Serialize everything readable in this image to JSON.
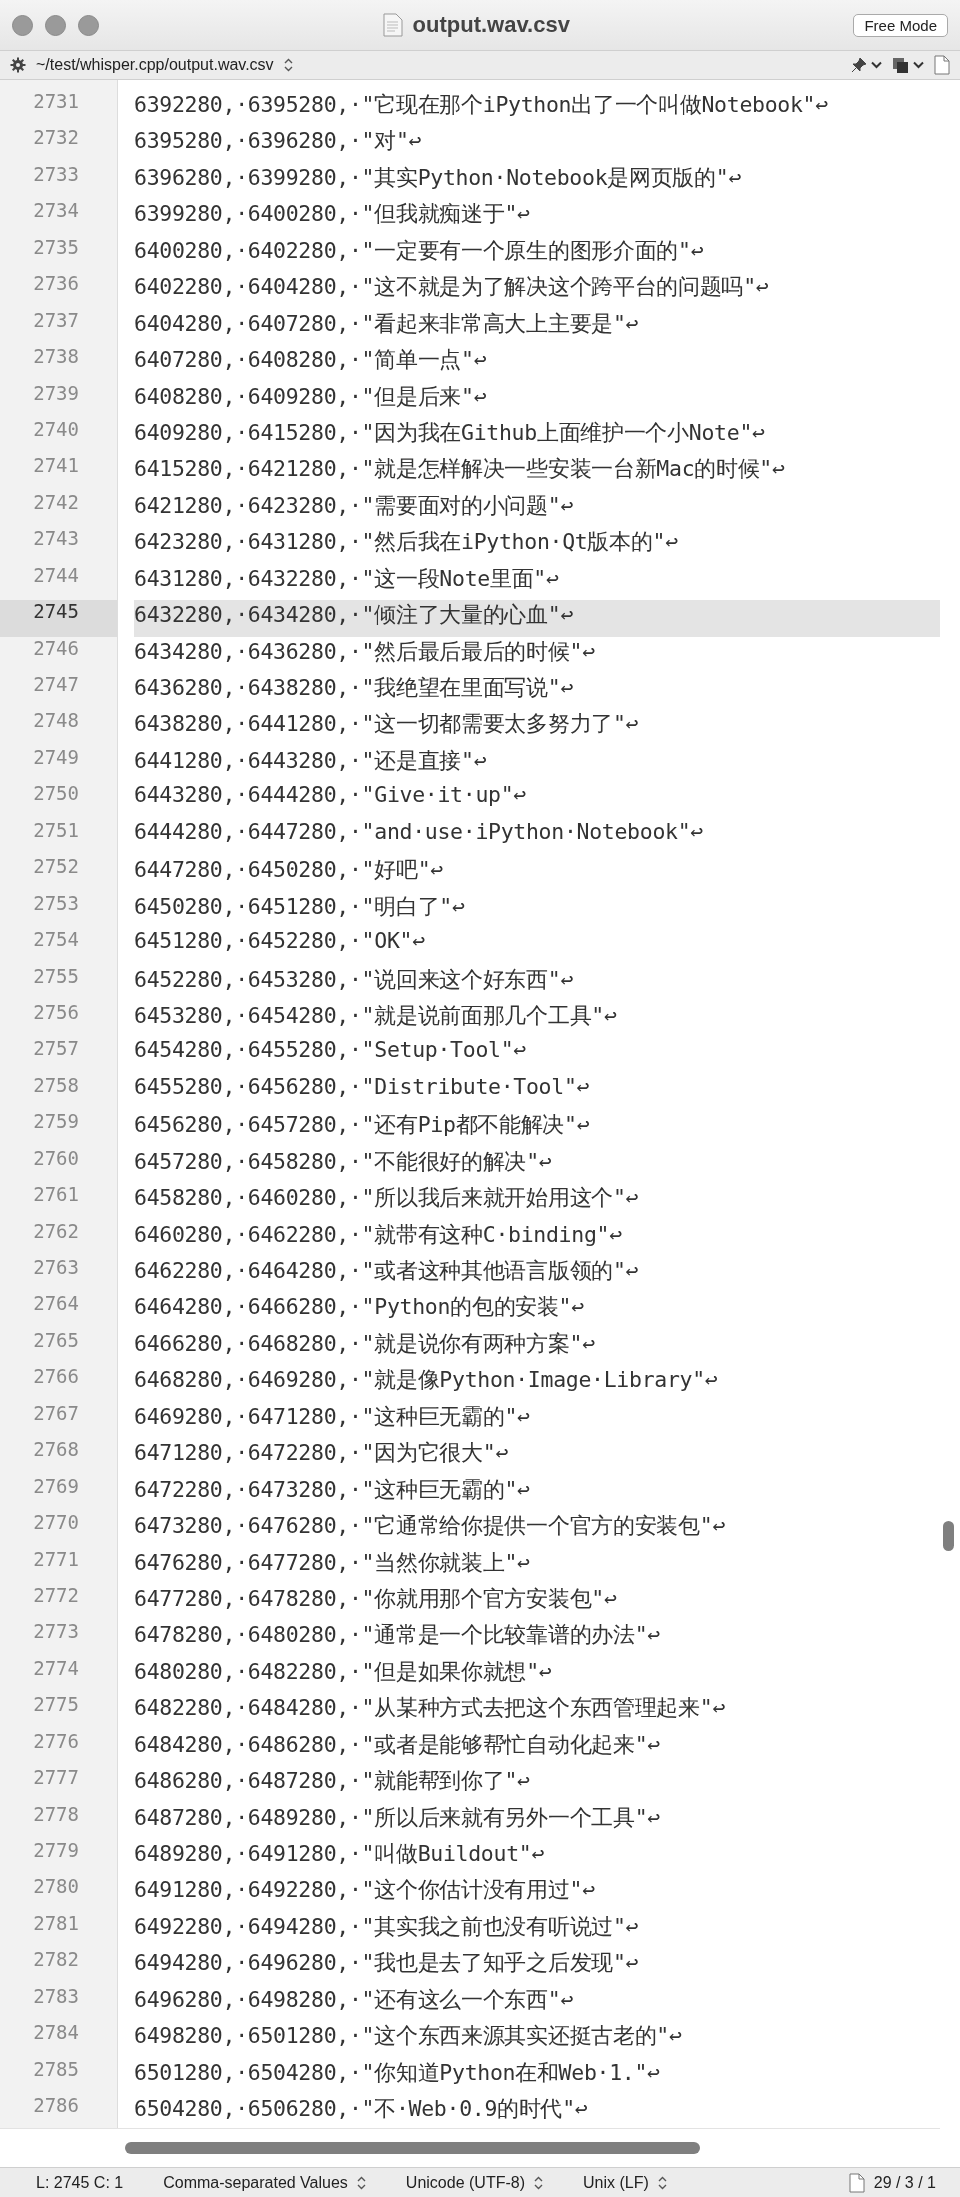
{
  "window": {
    "title": "output.wav.csv",
    "mode_button": "Free Mode"
  },
  "path_bar": {
    "path": "~/test/whisper.cpp/output.wav.csv"
  },
  "editor": {
    "lines": [
      {
        "number": "2731",
        "text": "6392280,·6395280,·\"它现在那个iPython出了一个叫做Notebook\"↩",
        "selected": false
      },
      {
        "number": "2732",
        "text": "6395280,·6396280,·\"对\"↩",
        "selected": false
      },
      {
        "number": "2733",
        "text": "6396280,·6399280,·\"其实Python·Notebook是网页版的\"↩",
        "selected": false
      },
      {
        "number": "2734",
        "text": "6399280,·6400280,·\"但我就痴迷于\"↩",
        "selected": false
      },
      {
        "number": "2735",
        "text": "6400280,·6402280,·\"一定要有一个原生的图形介面的\"↩",
        "selected": false
      },
      {
        "number": "2736",
        "text": "6402280,·6404280,·\"这不就是为了解决这个跨平台的问题吗\"↩",
        "selected": false
      },
      {
        "number": "2737",
        "text": "6404280,·6407280,·\"看起来非常高大上主要是\"↩",
        "selected": false
      },
      {
        "number": "2738",
        "text": "6407280,·6408280,·\"简单一点\"↩",
        "selected": false
      },
      {
        "number": "2739",
        "text": "6408280,·6409280,·\"但是后来\"↩",
        "selected": false
      },
      {
        "number": "2740",
        "text": "6409280,·6415280,·\"因为我在Github上面维护一个小Note\"↩",
        "selected": false
      },
      {
        "number": "2741",
        "text": "6415280,·6421280,·\"就是怎样解决一些安装一台新Mac的时候\"↩",
        "selected": false
      },
      {
        "number": "2742",
        "text": "6421280,·6423280,·\"需要面对的小问题\"↩",
        "selected": false
      },
      {
        "number": "2743",
        "text": "6423280,·6431280,·\"然后我在iPython·Qt版本的\"↩",
        "selected": false
      },
      {
        "number": "2744",
        "text": "6431280,·6432280,·\"这一段Note里面\"↩",
        "selected": false
      },
      {
        "number": "2745",
        "text": "6432280,·6434280,·\"倾注了大量的心血\"↩",
        "selected": true
      },
      {
        "number": "2746",
        "text": "6434280,·6436280,·\"然后最后最后的时候\"↩",
        "selected": false
      },
      {
        "number": "2747",
        "text": "6436280,·6438280,·\"我绝望在里面写说\"↩",
        "selected": false
      },
      {
        "number": "2748",
        "text": "6438280,·6441280,·\"这一切都需要太多努力了\"↩",
        "selected": false
      },
      {
        "number": "2749",
        "text": "6441280,·6443280,·\"还是直接\"↩",
        "selected": false
      },
      {
        "number": "2750",
        "text": "6443280,·6444280,·\"Give·it·up\"↩",
        "selected": false
      },
      {
        "number": "2751",
        "text": "6444280,·6447280,·\"and·use·iPython·Notebook\"↩",
        "selected": false
      },
      {
        "number": "2752",
        "text": "6447280,·6450280,·\"好吧\"↩",
        "selected": false
      },
      {
        "number": "2753",
        "text": "6450280,·6451280,·\"明白了\"↩",
        "selected": false
      },
      {
        "number": "2754",
        "text": "6451280,·6452280,·\"OK\"↩",
        "selected": false
      },
      {
        "number": "2755",
        "text": "6452280,·6453280,·\"说回来这个好东西\"↩",
        "selected": false
      },
      {
        "number": "2756",
        "text": "6453280,·6454280,·\"就是说前面那几个工具\"↩",
        "selected": false
      },
      {
        "number": "2757",
        "text": "6454280,·6455280,·\"Setup·Tool\"↩",
        "selected": false
      },
      {
        "number": "2758",
        "text": "6455280,·6456280,·\"Distribute·Tool\"↩",
        "selected": false
      },
      {
        "number": "2759",
        "text": "6456280,·6457280,·\"还有Pip都不能解决\"↩",
        "selected": false
      },
      {
        "number": "2760",
        "text": "6457280,·6458280,·\"不能很好的解决\"↩",
        "selected": false
      },
      {
        "number": "2761",
        "text": "6458280,·6460280,·\"所以我后来就开始用这个\"↩",
        "selected": false
      },
      {
        "number": "2762",
        "text": "6460280,·6462280,·\"就带有这种C·binding\"↩",
        "selected": false
      },
      {
        "number": "2763",
        "text": "6462280,·6464280,·\"或者这种其他语言版领的\"↩",
        "selected": false
      },
      {
        "number": "2764",
        "text": "6464280,·6466280,·\"Python的包的安装\"↩",
        "selected": false
      },
      {
        "number": "2765",
        "text": "6466280,·6468280,·\"就是说你有两种方案\"↩",
        "selected": false
      },
      {
        "number": "2766",
        "text": "6468280,·6469280,·\"就是像Python·Image·Library\"↩",
        "selected": false
      },
      {
        "number": "2767",
        "text": "6469280,·6471280,·\"这种巨无霸的\"↩",
        "selected": false
      },
      {
        "number": "2768",
        "text": "6471280,·6472280,·\"因为它很大\"↩",
        "selected": false
      },
      {
        "number": "2769",
        "text": "6472280,·6473280,·\"这种巨无霸的\"↩",
        "selected": false
      },
      {
        "number": "2770",
        "text": "6473280,·6476280,·\"它通常给你提供一个官方的安装包\"↩",
        "selected": false
      },
      {
        "number": "2771",
        "text": "6476280,·6477280,·\"当然你就装上\"↩",
        "selected": false
      },
      {
        "number": "2772",
        "text": "6477280,·6478280,·\"你就用那个官方安装包\"↩",
        "selected": false
      },
      {
        "number": "2773",
        "text": "6478280,·6480280,·\"通常是一个比较靠谱的办法\"↩",
        "selected": false
      },
      {
        "number": "2774",
        "text": "6480280,·6482280,·\"但是如果你就想\"↩",
        "selected": false
      },
      {
        "number": "2775",
        "text": "6482280,·6484280,·\"从某种方式去把这个东西管理起来\"↩",
        "selected": false
      },
      {
        "number": "2776",
        "text": "6484280,·6486280,·\"或者是能够帮忙自动化起来\"↩",
        "selected": false
      },
      {
        "number": "2777",
        "text": "6486280,·6487280,·\"就能帮到你了\"↩",
        "selected": false
      },
      {
        "number": "2778",
        "text": "6487280,·6489280,·\"所以后来就有另外一个工具\"↩",
        "selected": false
      },
      {
        "number": "2779",
        "text": "6489280,·6491280,·\"叫做Buildout\"↩",
        "selected": false
      },
      {
        "number": "2780",
        "text": "6491280,·6492280,·\"这个你估计没有用过\"↩",
        "selected": false
      },
      {
        "number": "2781",
        "text": "6492280,·6494280,·\"其实我之前也没有听说过\"↩",
        "selected": false
      },
      {
        "number": "2782",
        "text": "6494280,·6496280,·\"我也是去了知乎之后发现\"↩",
        "selected": false
      },
      {
        "number": "2783",
        "text": "6496280,·6498280,·\"还有这么一个东西\"↩",
        "selected": false
      },
      {
        "number": "2784",
        "text": "6498280,·6501280,·\"这个东西来源其实还挺古老的\"↩",
        "selected": false
      },
      {
        "number": "2785",
        "text": "6501280,·6504280,·\"你知道Python在和Web·1.\"↩",
        "selected": false
      },
      {
        "number": "2786",
        "text": "6504280,·6506280,·\"不·Web·0.9的时代\"↩",
        "selected": false
      }
    ]
  },
  "status_bar": {
    "position": "L: 2745 C: 1",
    "syntax": "Comma-separated Values",
    "encoding": "Unicode (UTF-8)",
    "line_endings": "Unix (LF)",
    "counts": "29 / 3 / 1"
  }
}
